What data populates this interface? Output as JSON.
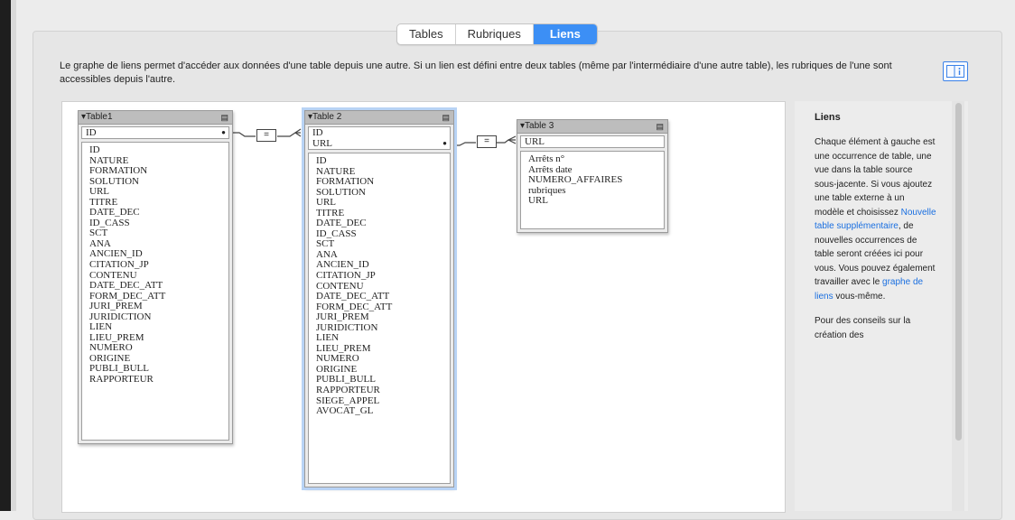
{
  "tabs": [
    {
      "label": "Tables"
    },
    {
      "label": "Rubriques"
    },
    {
      "label": "Liens"
    }
  ],
  "description": "Le graphe de liens permet d'accéder aux données d'une table depuis une autre. Si un lien est défini entre deux tables (même par l'intermédiaire d'une autre table), les rubriques de l'une sont accessibles depuis l'autre.",
  "graph": {
    "relationship_symbol": "=",
    "tables": [
      {
        "name": "Table1",
        "keys": [
          "ID"
        ],
        "fields": [
          "ID",
          "NATURE",
          "FORMATION",
          "SOLUTION",
          "URL",
          "TITRE",
          "DATE_DEC",
          "ID_CASS",
          "SCT",
          "ANA",
          "ANCIEN_ID",
          "CITATION_JP",
          "CONTENU",
          "DATE_DEC_ATT",
          "FORM_DEC_ATT",
          "JURI_PREM",
          "JURIDICTION",
          "LIEN",
          "LIEU_PREM",
          "NUMERO",
          "ORIGINE",
          "PUBLI_BULL",
          "RAPPORTEUR"
        ]
      },
      {
        "name": "Table 2",
        "keys": [
          "ID",
          "URL"
        ],
        "fields": [
          "ID",
          "NATURE",
          "FORMATION",
          "SOLUTION",
          "URL",
          "TITRE",
          "DATE_DEC",
          "ID_CASS",
          "SCT",
          "ANA",
          "ANCIEN_ID",
          "CITATION_JP",
          "CONTENU",
          "DATE_DEC_ATT",
          "FORM_DEC_ATT",
          "JURI_PREM",
          "JURIDICTION",
          "LIEN",
          "LIEU_PREM",
          "NUMERO",
          "ORIGINE",
          "PUBLI_BULL",
          "RAPPORTEUR",
          "SIEGE_APPEL",
          "AVOCAT_GL"
        ]
      },
      {
        "name": "Table 3",
        "keys": [
          "URL"
        ],
        "fields": [
          "Arrêts n°",
          "Arrêts date",
          "NUMERO_AFFAIRES",
          "rubriques",
          "URL"
        ]
      }
    ]
  },
  "sidebar": {
    "title": "Liens",
    "text_1": "Chaque élément à gauche est une occurrence de table, une vue dans la table source sous-jacente. Si vous ajoutez une table externe à un modèle et choisissez ",
    "link_1": "Nouvelle table supplémentaire",
    "text_2": ", de nouvelles occurrences de table seront créées ici pour vous. Vous pouvez également travailler avec le ",
    "link_2": "graphe de liens",
    "text_3": " vous-même.",
    "text_4": "Pour des conseils sur la création des"
  },
  "colors": {
    "accent": "#3c8ff5",
    "link": "#1a6fe0",
    "selection_glow": "#b8d3f5"
  }
}
